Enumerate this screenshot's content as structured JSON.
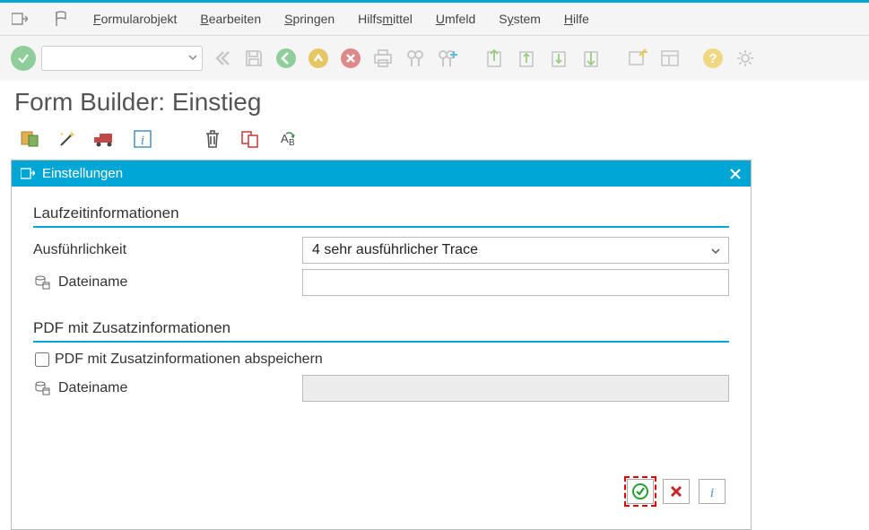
{
  "menu": {
    "formularobjekt": "Formularobjekt",
    "bearbeiten": "Bearbeiten",
    "springen": "Springen",
    "hilfsmittel": "Hilfsmittel",
    "umfeld": "Umfeld",
    "system": "System",
    "hilfe": "Hilfe"
  },
  "page": {
    "title": "Form Builder: Einstieg"
  },
  "dialog": {
    "title": "Einstellungen",
    "group1": {
      "title": "Laufzeitinformationen",
      "row1_label": "Ausführlichkeit",
      "row1_value": "4 sehr ausführlicher Trace",
      "row2_label": "Dateiname",
      "row2_value": ""
    },
    "group2": {
      "title": "PDF mit Zusatzinformationen",
      "checkbox_label": "PDF mit Zusatzinformationen abspeichern",
      "row1_label": "Dateiname",
      "row1_value": ""
    }
  }
}
